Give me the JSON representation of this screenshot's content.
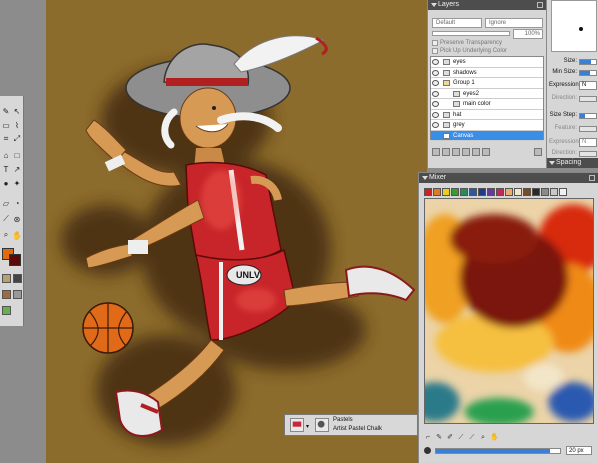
{
  "layers_panel": {
    "title": "Layers",
    "composite_method": "Default",
    "depth_method": "Ignore",
    "opacity": "100%",
    "option_preserve_transparency": "Preserve Transparency",
    "option_pick_up_underlying": "Pick Up Underlying Color",
    "layers": [
      {
        "name": "eyes",
        "indent": 0,
        "active": false
      },
      {
        "name": "shadows",
        "indent": 0,
        "active": false
      },
      {
        "name": "Group 1",
        "indent": 0,
        "active": false
      },
      {
        "name": "eyes2",
        "indent": 1,
        "active": false
      },
      {
        "name": "main color",
        "indent": 1,
        "active": false
      },
      {
        "name": "hat",
        "indent": 0,
        "active": false
      },
      {
        "name": "grey",
        "indent": 0,
        "active": false
      },
      {
        "name": "Canvas",
        "indent": 0,
        "active": true
      }
    ]
  },
  "brush_controls": {
    "size_label": "Size:",
    "min_size_label": "Min Size:",
    "expression_label": "Expression:",
    "expression_value": "N",
    "direction_label": "Direction:",
    "size_step_label": "Size Step:",
    "feature_label": "Feature:",
    "expression2_label": "Expression:",
    "expression2_value": "N",
    "direction2_label": "Direction:",
    "spacing_label": "Spacing"
  },
  "mixer_panel": {
    "title": "Mixer",
    "swatches": [
      "#cc2222",
      "#e07a22",
      "#e6d020",
      "#3a9a3a",
      "#2a8a5a",
      "#2a5aa0",
      "#223a8a",
      "#6a3a9a",
      "#c02a5a",
      "#e8b070",
      "#f2e6c8",
      "#7a4a22",
      "#2a2a2a",
      "#8a8a8a",
      "#c8c8c8",
      "#f0f0f0"
    ],
    "brush_size": "20 px",
    "size_fill": 0.92
  },
  "brush_selector": {
    "category": "Pastels",
    "variant": "Artist Pastel Chalk"
  },
  "artwork": {
    "shirt_label": "UNLV"
  }
}
